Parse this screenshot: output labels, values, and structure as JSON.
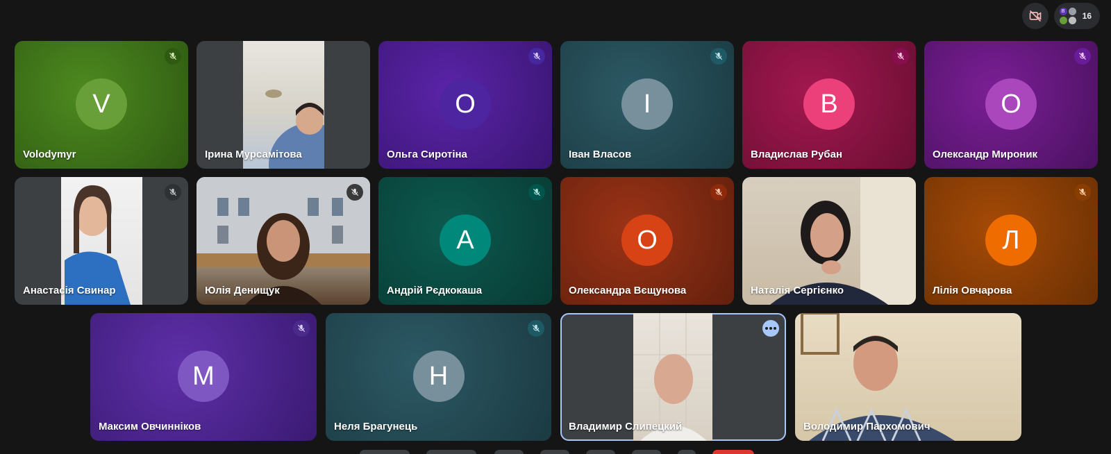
{
  "header": {
    "people_count": "16",
    "mini_avatar_letters": [
      "В",
      "",
      "",
      ""
    ]
  },
  "participants": [
    {
      "name": "Volodymyr",
      "initial": "V",
      "type": "avatar",
      "avatar_color": "#689f38",
      "mic_bg": "#33691e"
    },
    {
      "name": "Ірина Мурсамітова",
      "initial": "",
      "type": "video"
    },
    {
      "name": "Ольга Сиротіна",
      "initial": "О",
      "type": "avatar",
      "avatar_color": "#5e35b1",
      "mic_bg": "#4527a0"
    },
    {
      "name": "Іван Власов",
      "initial": "І",
      "type": "avatar",
      "avatar_color": "#78909c",
      "mic_bg": "#1e5a66"
    },
    {
      "name": "Владислав Рубан",
      "initial": "В",
      "type": "avatar",
      "avatar_color": "#ec407a",
      "mic_bg": "#880e4f"
    },
    {
      "name": "Олександр Мироник",
      "initial": "О",
      "type": "avatar",
      "avatar_color": "#ab47bc",
      "mic_bg": "#6a1b9a"
    },
    {
      "name": "Анастасія Свинар",
      "initial": "",
      "type": "video"
    },
    {
      "name": "Юлія Денищук",
      "initial": "",
      "type": "video"
    },
    {
      "name": "Андрій Рєдкокаша",
      "initial": "А",
      "type": "avatar",
      "avatar_color": "#00897b",
      "mic_bg": "#00564d"
    },
    {
      "name": "Олександра Вєщунова",
      "initial": "О",
      "type": "avatar",
      "avatar_color": "#d84315",
      "mic_bg": "#8d2a0b"
    },
    {
      "name": "Наталія Сергієнко",
      "initial": "",
      "type": "video"
    },
    {
      "name": "Лілія Овчарова",
      "initial": "Л",
      "type": "avatar",
      "avatar_color": "#ef6c00",
      "mic_bg": "#8a3d00"
    },
    {
      "name": "Максим Овчинніков",
      "initial": "М",
      "type": "avatar",
      "avatar_color": "#7e57c2",
      "mic_bg": "#4a2a8a"
    },
    {
      "name": "Неля Брагунець",
      "initial": "Н",
      "type": "avatar",
      "avatar_color": "#78909c",
      "mic_bg": "#1e5a66"
    },
    {
      "name": "Владимир Слипецкий",
      "initial": "",
      "type": "video"
    },
    {
      "name": "Володимир Пархомович",
      "initial": "",
      "type": "video"
    }
  ]
}
